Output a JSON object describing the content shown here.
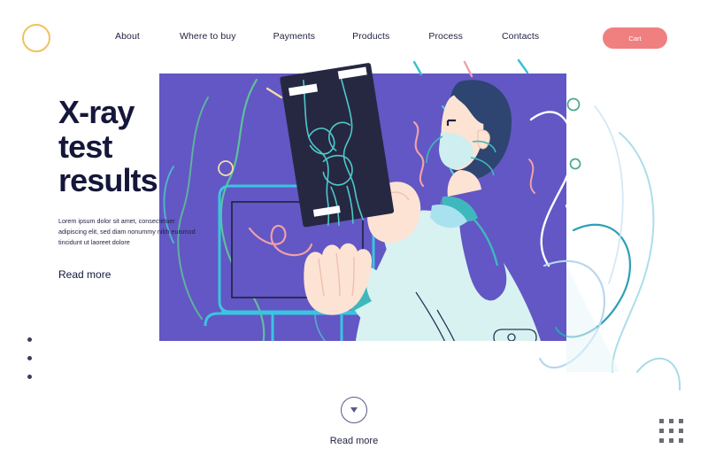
{
  "header": {
    "logo_icon": "circle-outline-logo",
    "logo_color": "#eec25f",
    "nav_items": [
      {
        "label": "About"
      },
      {
        "label": "Where to buy"
      },
      {
        "label": "Payments"
      },
      {
        "label": "Products"
      },
      {
        "label": "Process"
      },
      {
        "label": "Contacts"
      }
    ],
    "cart_label": "Cart",
    "cart_color": "#f08080"
  },
  "hero": {
    "headline_line1": "X-ray",
    "headline_line2": "test",
    "headline_line3": "results",
    "paragraph": "Lorem ipsum dolor sit amet, consectetuer adipiscing elit, sed diam nonummy nibh euismod tincidunt ut laoreet dolore",
    "read_more_label": "Read more"
  },
  "illustration": {
    "panel_color": "#6257c4",
    "xray_film_color": "#262842",
    "xray_line_color": "#4ec9c9",
    "coat_color": "#d8f2f2",
    "cuff_color": "#3fb8bd",
    "skin_color": "#fde3d4",
    "hair_color": "#2d4570",
    "mask_color": "#cfeef0",
    "monitor_outline_color": "#3bc4e0",
    "squiggle_color": "#f0a0a8",
    "leaf_color": "#5fc09a",
    "scene_description": "Doctor in white coat and teal mask holding a knee X-ray film up to the light in front of a monitor"
  },
  "side_nav": {
    "dots": [
      {
        "active": true
      },
      {
        "active": false
      },
      {
        "active": false
      }
    ]
  },
  "footer": {
    "scroll_icon": "chevron-down-icon",
    "read_more_label": "Read more",
    "grid_icon": "dot-grid-icon"
  }
}
